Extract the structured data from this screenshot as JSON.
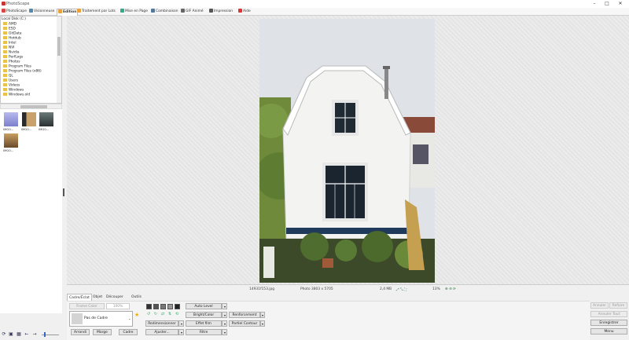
{
  "app": {
    "title": "PhotoScape"
  },
  "tabs": [
    {
      "label": "PhotoScape",
      "color": "#d44"
    },
    {
      "label": "Visionneuse",
      "color": "#58a"
    },
    {
      "label": "Edition",
      "color": "#e9a23b"
    },
    {
      "label": "Traitement par Lots",
      "color": "#e9a23b"
    },
    {
      "label": "Mise en Page",
      "color": "#3a8"
    },
    {
      "label": "Combinaison",
      "color": "#579"
    },
    {
      "label": "GIF Animé",
      "color": "#666"
    },
    {
      "label": "Impression",
      "color": "#555"
    },
    {
      "label": "Aide",
      "color": "#d33"
    }
  ],
  "active_tab": "Edition",
  "tree": {
    "root": "Local Disk (C:)",
    "items": [
      "AMD",
      "ESD",
      "GitData",
      "Hotdub",
      "Intel",
      "NVI",
      "Nvidia",
      "PerfLogs",
      "Photos",
      "Program Files",
      "Program Files (x86)",
      "QL",
      "Users",
      "Videos",
      "Windows",
      "Windows.old"
    ]
  },
  "thumbnails": [
    {
      "caption": "IMG0...",
      "color": "#8a8ed6"
    },
    {
      "caption": "IMG0...",
      "color": "#8a6a3a"
    },
    {
      "caption": "IMG0...",
      "color": "#3b4a4a"
    },
    {
      "caption": "IMG0...",
      "color": "#a07a3a"
    }
  ],
  "infobar": {
    "filename": "14931f153.jpg",
    "photo_size": "Photo 3803 x 5705",
    "file_size": "2,4 MB",
    "zoom": "13%"
  },
  "bottom_tabs": [
    "Cadre/Éclat",
    "Objet",
    "Découper",
    "Outils"
  ],
  "panel": {
    "frame_prev": "Frame Color",
    "frame_value": "100%",
    "frame_select": "Pas de Cadre",
    "btn_round": "Arrondi",
    "btn_margin": "Marge",
    "btn_frame": "Cadre",
    "btn_auto_level": "Auto Level",
    "btn_bright": "Bright/Color",
    "btn_filters": "Effet film",
    "btn_filter": "Filtre",
    "btn_resize": "Redimensionner",
    "btn_adjust": "Ajuster...",
    "btn_clarity": "Renforcement",
    "btn_partial": "Partiel Contour"
  },
  "right_buttons": {
    "undo": "Annuler",
    "redo": "Refaire",
    "undo_all": "Annuler Tout",
    "save": "Enregistrer",
    "menu": "Menu"
  }
}
